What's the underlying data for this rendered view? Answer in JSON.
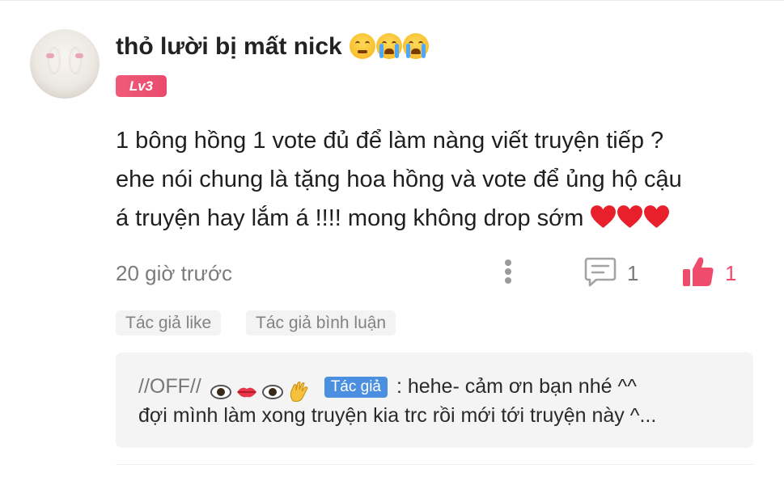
{
  "comment": {
    "username": "thỏ lười bị mất nick",
    "level": "Lv3",
    "body_line1": "1 bông hồng 1 vote đủ để làm nàng viết truyện tiếp ?",
    "body_line2": "ehe nói chung là tặng hoa hồng và vote để ủng hộ cậu",
    "body_line3": "á truyện hay lắm á !!!! mong không drop sớm",
    "time": "20 giờ trước",
    "reply_count": "1",
    "like_count": "1",
    "tags": [
      "Tác giả like",
      "Tác giả bình luận"
    ]
  },
  "reply": {
    "author": "//OFF//",
    "author_badge": "Tác giả",
    "line1_text": ": hehe- cảm ơn bạn nhé ^^",
    "line2_text": "đợi mình làm xong truyện kia trc rồi mới tới truyện này ^..."
  },
  "colors": {
    "accent_pink": "#ef4b6c",
    "author_badge_blue": "#4a8fe0",
    "heart_red": "#e8202c"
  }
}
